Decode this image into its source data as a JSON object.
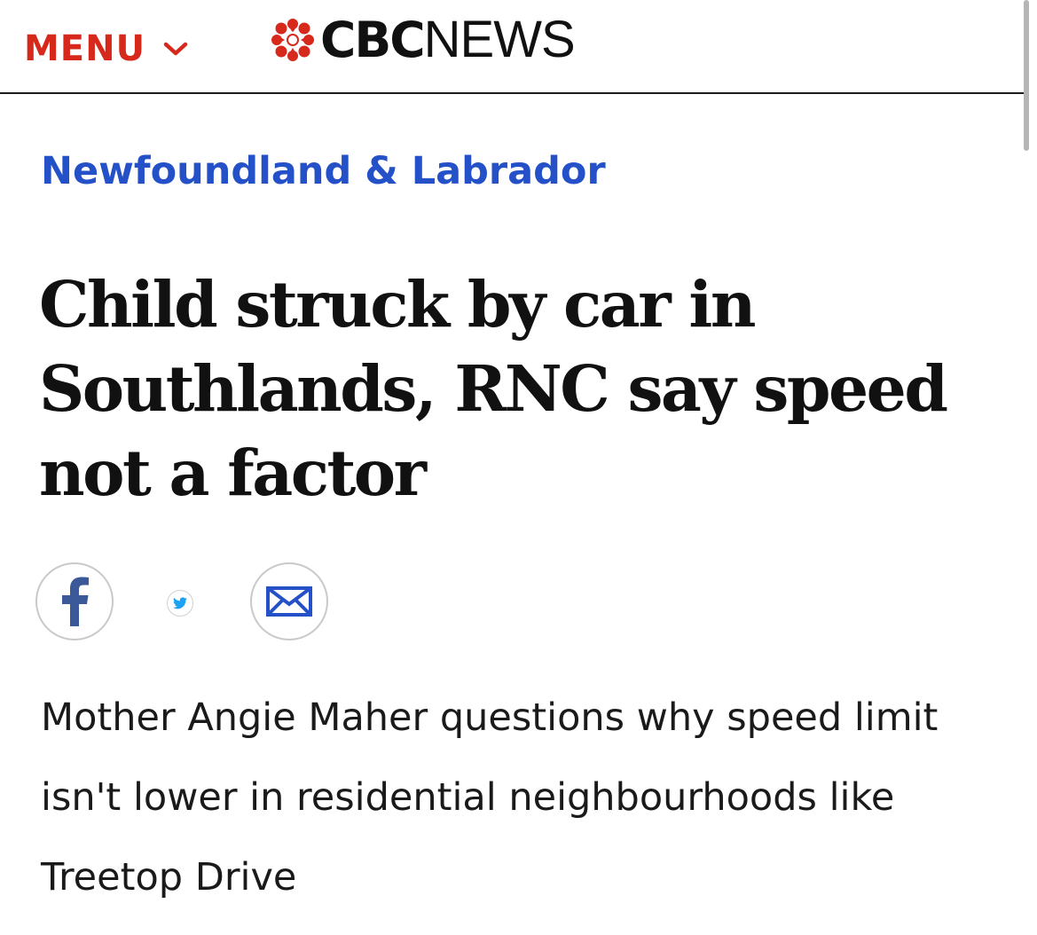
{
  "header": {
    "menu_label": "MENU",
    "menu_icon": "chevron-down-icon",
    "logo_cbc": "CBC",
    "logo_news": "NEWS",
    "logo_icon": "cbc-gem-icon"
  },
  "article": {
    "section": "Newfoundland & Labrador",
    "headline": "Child struck by car in Southlands, RNC say speed not a factor",
    "subheadline": "Mother Angie Maher questions why speed limit isn't lower in residential neighbourhoods like Treetop Drive"
  },
  "share": {
    "facebook_icon": "facebook-icon",
    "twitter_icon": "twitter-icon",
    "email_icon": "email-icon"
  },
  "colors": {
    "brand_red": "#d6291c",
    "section_blue": "#2450c8",
    "facebook_blue": "#3b5998",
    "twitter_blue": "#1da1f2",
    "email_blue": "#2450c8"
  }
}
